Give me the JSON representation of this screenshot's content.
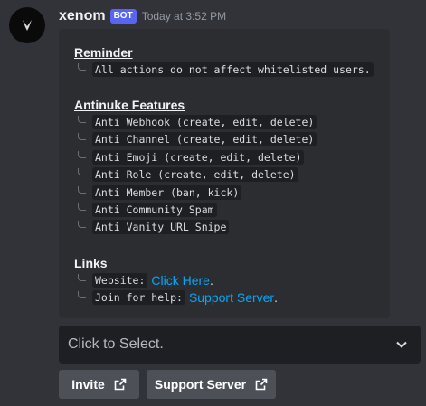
{
  "message": {
    "username": "xenom",
    "bot_tag": "BOT",
    "timestamp": "Today at 3:52 PM",
    "avatar_icon": "xenom-logo-icon"
  },
  "embed": {
    "reminder_title": "Reminder",
    "reminder_text": "All actions do not affect whitelisted users.",
    "features_title": "Antinuke Features",
    "features": [
      "Anti Webhook (create, edit, delete)",
      "Anti Channel (create, edit, delete)",
      "Anti Emoji (create, edit, delete)",
      "Anti Role (create, edit, delete)",
      "Anti Member (ban, kick)",
      "Anti Community Spam",
      "Anti Vanity URL Snipe"
    ],
    "links_title": "Links",
    "website_label": "Website:",
    "website_link": "Click Here",
    "website_suffix": ".",
    "help_label": "Join for help:",
    "help_link": "Support Server",
    "help_suffix": "."
  },
  "select_menu": {
    "placeholder": "Click to Select."
  },
  "buttons": {
    "invite": "Invite",
    "support": "Support Server"
  },
  "colors": {
    "background": "#313338",
    "embed": "#2b2d31",
    "link": "#00a8fc",
    "bot_tag": "#5865f2",
    "button": "#4e5058"
  }
}
